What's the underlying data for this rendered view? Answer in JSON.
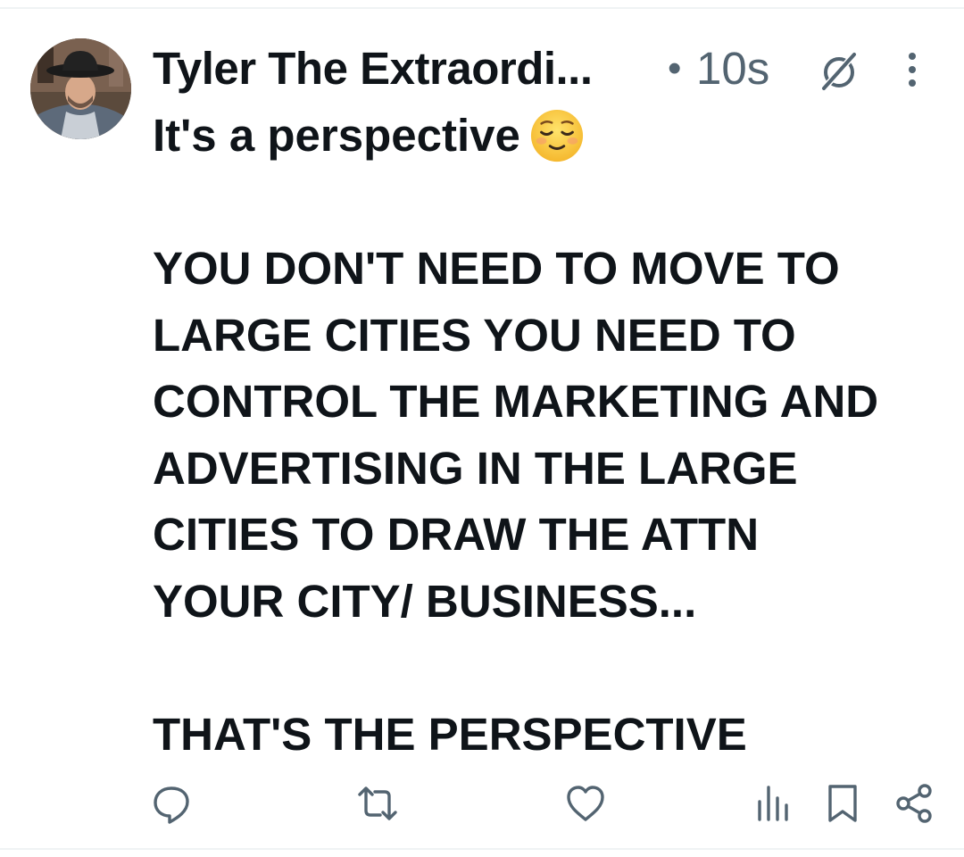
{
  "post": {
    "author": {
      "display_name": "Tyler The Extraordi...",
      "avatar_icon": "user-avatar-cowboy-hat"
    },
    "separator": "•",
    "time": "10s",
    "header_icons": [
      "grok-icon",
      "more-options-icon"
    ],
    "text_lines": [
      "It's a perspective",
      "",
      "YOU DON'T NEED TO MOVE TO",
      "LARGE CITIES YOU NEED TO",
      "CONTROL THE MARKETING AND",
      "ADVERTISING IN THE LARGE",
      "CITIES TO DRAW THE ATTN",
      "YOUR CITY/ BUSINESS...",
      "",
      "THAT'S THE PERSPECTIVE"
    ],
    "emoji": "relieved-face-emoji"
  },
  "actions": [
    "reply-icon",
    "repost-icon",
    "like-icon",
    "views-icon",
    "bookmark-icon",
    "share-icon"
  ],
  "colors": {
    "text_primary": "#0f1419",
    "text_secondary": "#536471",
    "divider": "#eff3f4",
    "icon": "#536471"
  }
}
